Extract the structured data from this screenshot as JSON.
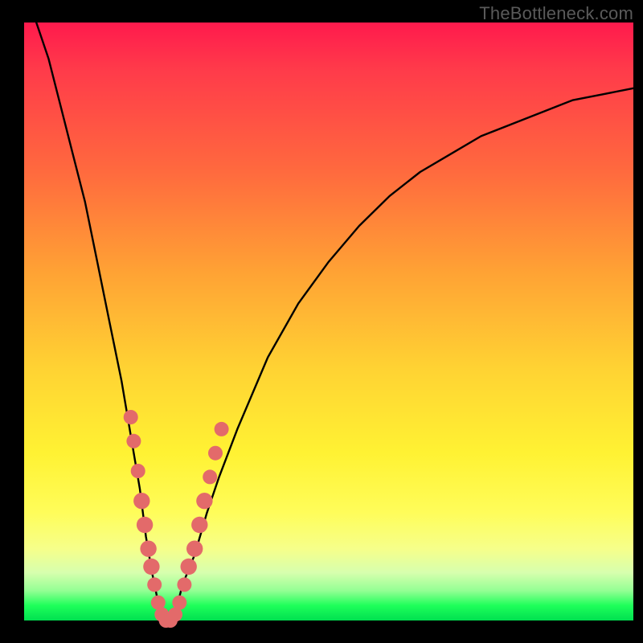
{
  "watermark": "TheBottleneck.com",
  "chart_data": {
    "type": "line",
    "title": "",
    "xlabel": "",
    "ylabel": "",
    "xlim": [
      0,
      100
    ],
    "ylim": [
      0,
      100
    ],
    "background_gradient": [
      "#ff1a4d",
      "#ff6a3e",
      "#ffd333",
      "#fffd5a",
      "#1eff5a"
    ],
    "series": [
      {
        "name": "bottleneck-curve",
        "x": [
          2,
          4,
          6,
          8,
          10,
          12,
          14,
          16,
          18,
          19,
          20,
          21,
          22,
          23,
          24,
          25,
          26,
          28,
          30,
          32,
          35,
          40,
          45,
          50,
          55,
          60,
          65,
          70,
          75,
          80,
          85,
          90,
          95,
          100
        ],
        "values": [
          100,
          94,
          86,
          78,
          70,
          60,
          50,
          40,
          28,
          22,
          14,
          8,
          3,
          0,
          0,
          2,
          6,
          11,
          18,
          24,
          32,
          44,
          53,
          60,
          66,
          71,
          75,
          78,
          81,
          83,
          85,
          87,
          88,
          89
        ]
      }
    ],
    "markers": {
      "name": "highlighted-points",
      "color": "#e36a6a",
      "points": [
        {
          "x": 17.5,
          "y": 34
        },
        {
          "x": 18.0,
          "y": 30
        },
        {
          "x": 18.7,
          "y": 25
        },
        {
          "x": 19.3,
          "y": 20
        },
        {
          "x": 19.8,
          "y": 16
        },
        {
          "x": 20.4,
          "y": 12
        },
        {
          "x": 20.9,
          "y": 9
        },
        {
          "x": 21.4,
          "y": 6
        },
        {
          "x": 22.0,
          "y": 3
        },
        {
          "x": 22.6,
          "y": 1
        },
        {
          "x": 23.3,
          "y": 0
        },
        {
          "x": 24.0,
          "y": 0
        },
        {
          "x": 24.8,
          "y": 1
        },
        {
          "x": 25.5,
          "y": 3
        },
        {
          "x": 26.3,
          "y": 6
        },
        {
          "x": 27.0,
          "y": 9
        },
        {
          "x": 28.0,
          "y": 12
        },
        {
          "x": 28.8,
          "y": 16
        },
        {
          "x": 29.6,
          "y": 20
        },
        {
          "x": 30.5,
          "y": 24
        },
        {
          "x": 31.4,
          "y": 28
        },
        {
          "x": 32.4,
          "y": 32
        }
      ]
    }
  }
}
